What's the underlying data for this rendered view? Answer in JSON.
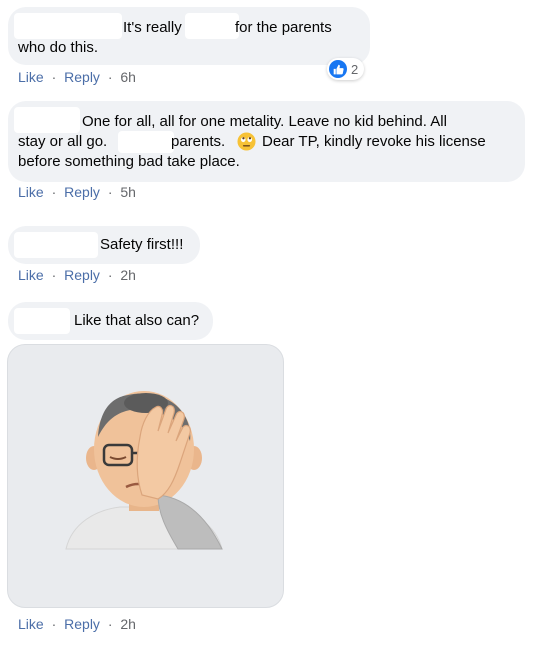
{
  "comments": [
    {
      "line1": "It's really",
      "line1b": "for the parents",
      "line2": "who do this.",
      "like": "Like",
      "reply": "Reply",
      "time": "6h",
      "reaction_count": "2"
    },
    {
      "line1": "One for all, all for one metality. Leave no kid behind. All",
      "line2a": "stay or all go.",
      "line2b": "parents.",
      "line2c": "Dear TP, kindly revoke his license",
      "line3": "before something bad take place.",
      "like": "Like",
      "reply": "Reply",
      "time": "5h"
    },
    {
      "line1": "Safety first!!!",
      "like": "Like",
      "reply": "Reply",
      "time": "2h"
    },
    {
      "line1": "Like that also can?",
      "sticker": "facepalm-sticker",
      "like": "Like",
      "reply": "Reply",
      "time": "2h"
    }
  ],
  "separator": "·",
  "colors": {
    "bubble": "#f0f2f5",
    "action_link": "#4b6ea8",
    "meta_text": "#65676b",
    "like_blue": "#1877f2"
  }
}
